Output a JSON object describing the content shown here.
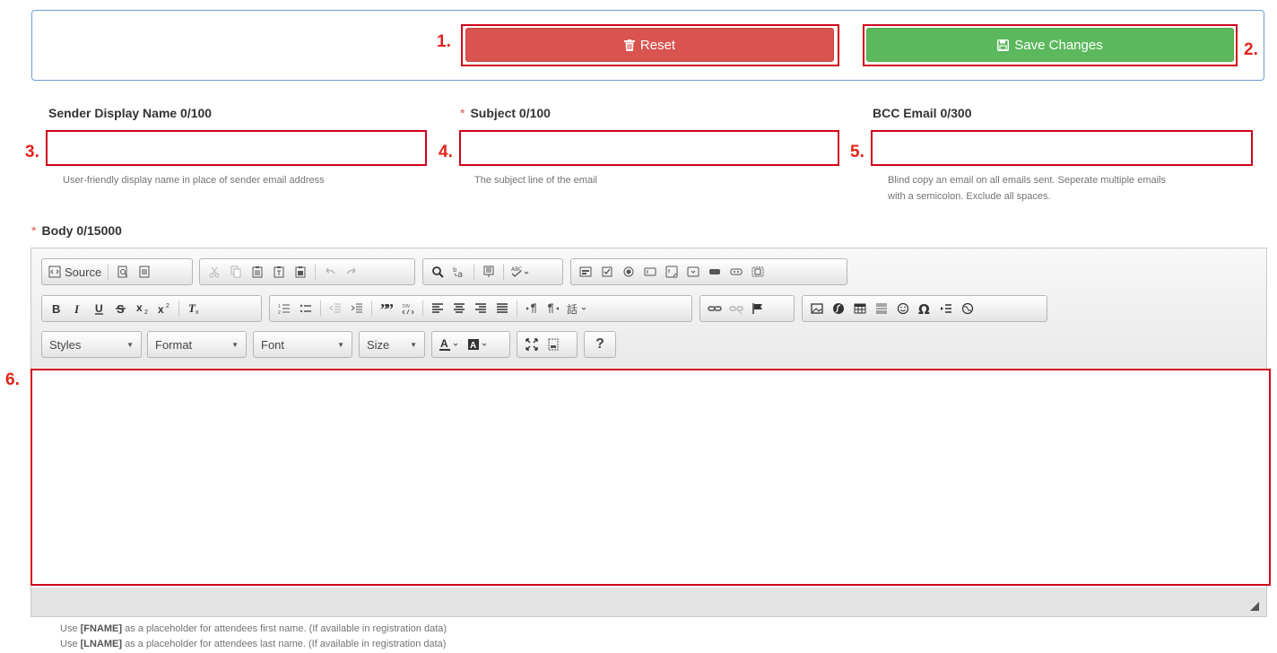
{
  "annotations": [
    "1.",
    "2.",
    "3.",
    "4.",
    "5.",
    "6."
  ],
  "actions": {
    "reset_label": "Reset",
    "save_label": "Save Changes",
    "reset_color": "#d9534f",
    "save_color": "#5cb85c"
  },
  "fields": {
    "sender": {
      "label": "Sender Display Name 0/100",
      "value": "",
      "help": "User-friendly display name in place of sender email address"
    },
    "subject": {
      "required_mark": "*",
      "label": "Subject 0/100",
      "value": "",
      "help": "The subject line of the email"
    },
    "bcc": {
      "label": "BCC Email 0/300",
      "value": "",
      "help_line1": "Blind copy an email on all emails sent. Seperate multiple emails",
      "help_line2": "with a semicolon. Exclude all spaces."
    },
    "body": {
      "required_mark": "*",
      "label": "Body 0/15000"
    }
  },
  "editor": {
    "source_label": "Source",
    "combos": {
      "styles": "Styles",
      "format": "Format",
      "font": "Font",
      "size": "Size"
    },
    "help_button": "?",
    "content": ""
  },
  "notes": {
    "fname_prefix": "Use",
    "fname_token": "[FNAME]",
    "fname_suffix": "as a placeholder for attendees first name. (If available in registration data)",
    "lname_prefix": "Use",
    "lname_token": "[LNAME]",
    "lname_suffix": "as a placeholder for attendees last name. (If available in registration data)"
  }
}
